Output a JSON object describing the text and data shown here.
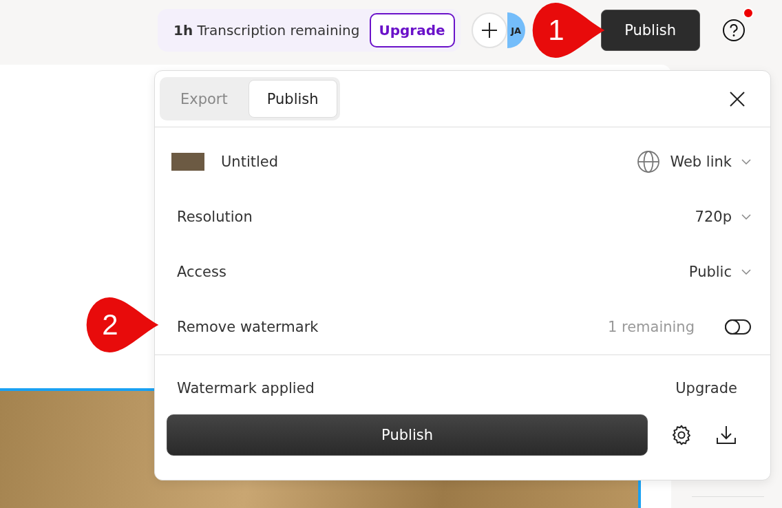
{
  "top_bar": {
    "transcription": {
      "amount": "1h",
      "label": "Transcription remaining"
    },
    "upgrade_button": "Upgrade",
    "avatar_initials": "JA",
    "publish_button": "Publish",
    "help_notification": true
  },
  "annotations": [
    {
      "number": "1"
    },
    {
      "number": "2"
    }
  ],
  "publish_panel": {
    "tabs": [
      {
        "label": "Export",
        "selected": false
      },
      {
        "label": "Publish",
        "selected": true
      }
    ],
    "rows": [
      {
        "kind": "title",
        "label": "Untitled",
        "value": "Web link"
      },
      {
        "kind": "select",
        "label": "Resolution",
        "value": "720p"
      },
      {
        "kind": "select",
        "label": "Access",
        "value": "Public"
      },
      {
        "kind": "toggle",
        "label": "Remove watermark",
        "note": "1 remaining",
        "on": false
      }
    ],
    "footer": {
      "status": "Watermark applied",
      "upgrade_link": "Upgrade",
      "publish_button": "Publish"
    }
  }
}
